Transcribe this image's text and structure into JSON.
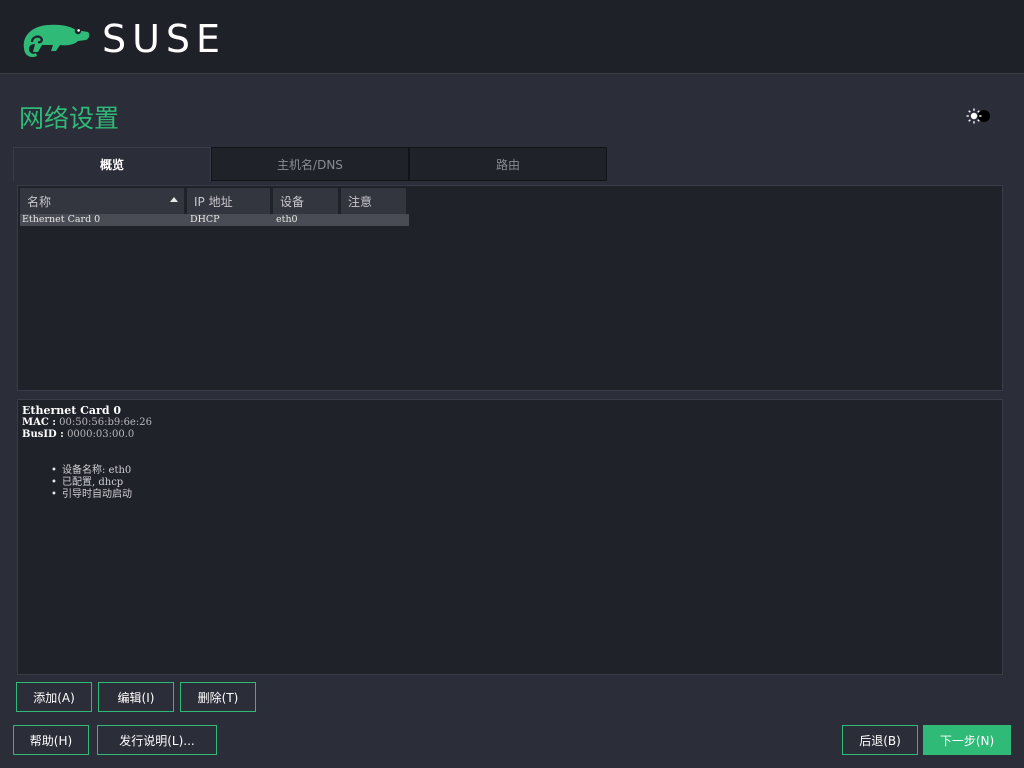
{
  "brand": {
    "name": "SUSE"
  },
  "page": {
    "title": "网络设置"
  },
  "tabs": [
    {
      "label": "概览",
      "active": true
    },
    {
      "label": "主机名/DNS",
      "active": false
    },
    {
      "label": "路由",
      "active": false
    }
  ],
  "table": {
    "columns": [
      "名称",
      "IP 地址",
      "设备",
      "注意"
    ],
    "rows": [
      {
        "name": "Ethernet Card 0",
        "ip": "DHCP",
        "device": "eth0",
        "note": ""
      }
    ]
  },
  "details": {
    "title": "Ethernet Card 0",
    "mac_label": "MAC :",
    "mac_value": "00:50:56:b9:6e:26",
    "busid_label": "BusID :",
    "busid_value": "0000:03:00.0",
    "bullets": [
      "设备名称: eth0",
      "已配置, dhcp",
      "引导时自动启动"
    ]
  },
  "actions": {
    "add": "添加(A)",
    "edit": "编辑(I)",
    "delete": "删除(T)"
  },
  "footer": {
    "help": "帮助(H)",
    "release_notes": "发行说明(L)...",
    "back": "后退(B)",
    "next": "下一步(N)"
  },
  "colors": {
    "accent": "#30ba78",
    "background": "#2b2d38",
    "header": "#1f2128"
  }
}
